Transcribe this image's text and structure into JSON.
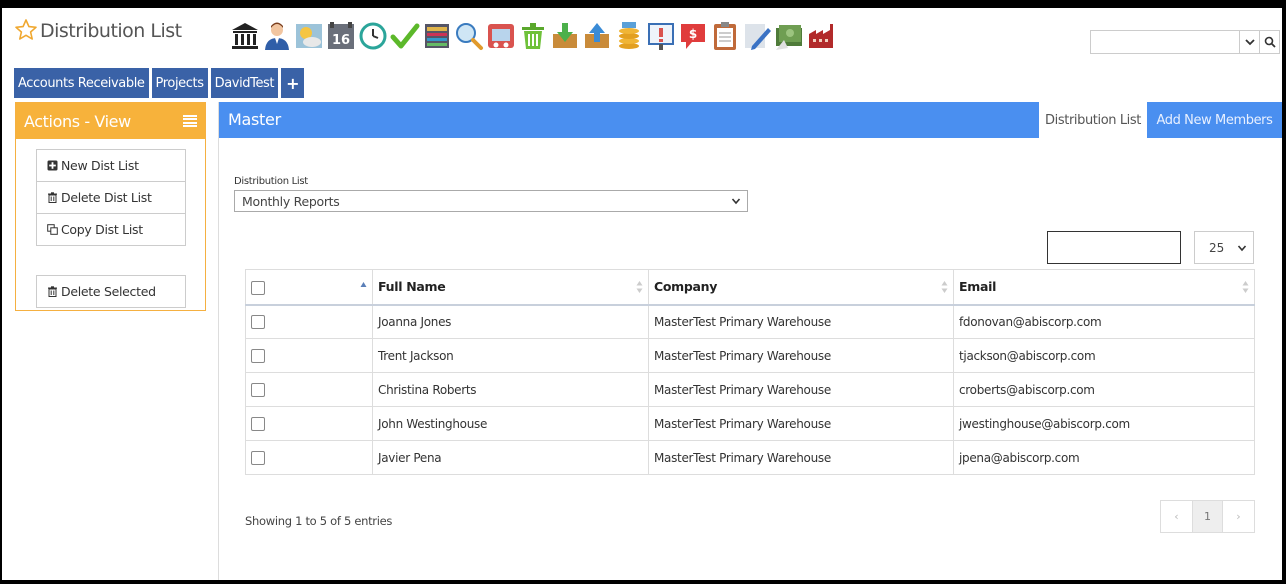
{
  "header": {
    "title": "Distribution List",
    "toolbar_icons": [
      "bank-icon",
      "user-icon",
      "weather-icon",
      "calendar-16-icon",
      "clock-icon",
      "checkmark-icon",
      "accounting-icon",
      "search-magnifier-icon",
      "truck-icon",
      "trash-bin-icon",
      "download-box-icon",
      "upload-box-icon",
      "coins-icon",
      "alert-board-icon",
      "money-chat-icon",
      "clipboard-icon",
      "edit-pencil-icon",
      "cash-icon",
      "factory-icon"
    ],
    "calendar_day": "16",
    "search": {
      "value": ""
    }
  },
  "tabs": [
    {
      "label": "Accounts Receivable"
    },
    {
      "label": "Projects"
    },
    {
      "label": "DavidTest"
    },
    {
      "label": "+"
    }
  ],
  "actions_panel": {
    "title": "Actions - View",
    "buttons": [
      {
        "label": "New Dist List",
        "icon": "plus-square-icon"
      },
      {
        "label": "Delete Dist List",
        "icon": "trash-icon"
      },
      {
        "label": "Copy Dist List",
        "icon": "copy-icon"
      },
      {
        "label": "Delete Selected",
        "icon": "trash-icon"
      }
    ]
  },
  "main": {
    "title": "Master",
    "tabs": [
      {
        "label": "Distribution List",
        "active": true
      },
      {
        "label": "Add New Members",
        "active": false
      }
    ],
    "dist_list": {
      "label": "Distribution List",
      "selected": "Monthly Reports"
    },
    "table_search": {
      "value": ""
    },
    "page_size": "25",
    "table": {
      "columns": [
        "",
        "Full Name",
        "Company",
        "Email"
      ],
      "rows": [
        {
          "full_name": "Joanna Jones",
          "company": "MasterTest Primary Warehouse",
          "email": "fdonovan@abiscorp.com"
        },
        {
          "full_name": "Trent Jackson",
          "company": "MasterTest Primary Warehouse",
          "email": "tjackson@abiscorp.com"
        },
        {
          "full_name": "Christina Roberts",
          "company": "MasterTest Primary Warehouse",
          "email": "croberts@abiscorp.com"
        },
        {
          "full_name": "John Westinghouse",
          "company": "MasterTest Primary Warehouse",
          "email": "jwestinghouse@abiscorp.com"
        },
        {
          "full_name": "Javier Pena",
          "company": "MasterTest Primary Warehouse",
          "email": "jpena@abiscorp.com"
        }
      ]
    },
    "showing_text": "Showing 1 to 5 of 5 entries",
    "pagination": {
      "prev": "‹",
      "current": "1",
      "next": "›"
    }
  },
  "colors": {
    "tab_blue": "#3a62a7",
    "actions_orange": "#f7b23b",
    "master_blue": "#4a8ff0"
  }
}
